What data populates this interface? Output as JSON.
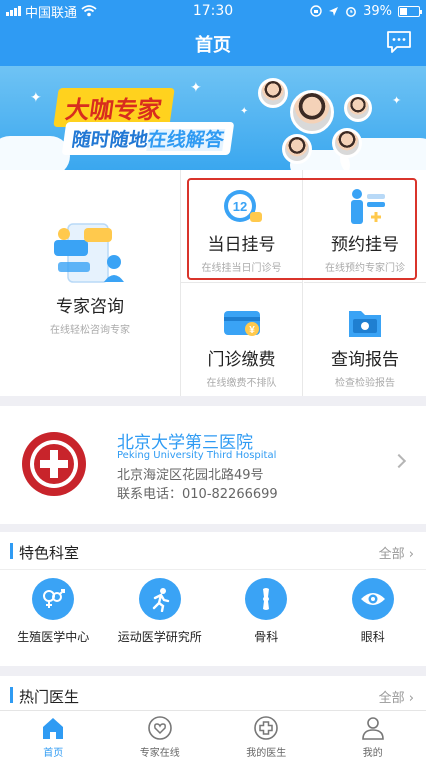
{
  "status_bar": {
    "carrier": "中国联通",
    "time": "17:30",
    "battery": "39%",
    "battery_level": 0.39
  },
  "header": {
    "title": "首页",
    "message_icon": "chat-bubble-icon"
  },
  "banner": {
    "headline": "大咖专家",
    "tagline_part1": "随时随地",
    "tagline_part2": "在线解答"
  },
  "services": {
    "consult": {
      "name": "专家咨询",
      "sub": "在线轻松咨询专家"
    },
    "same_day": {
      "name": "当日挂号",
      "sub": "在线挂当日门诊号",
      "icon_text": "12"
    },
    "appointment": {
      "name": "预约挂号",
      "sub": "在线预约专家门诊"
    },
    "payment": {
      "name": "门诊缴费",
      "sub": "在线缴费不排队",
      "icon_text": "¥"
    },
    "report": {
      "name": "查询报告",
      "sub": "检查检验报告"
    }
  },
  "hospital": {
    "name": "北京大学第三医院",
    "name_en": "Peking University Third Hospital",
    "address": "北京海淀区花园北路49号",
    "phone": "联系电话：010-82266699"
  },
  "departments": {
    "title": "特色科室",
    "more": "全部",
    "items": [
      {
        "label": "生殖医学中心",
        "icon": "gender-symbols-icon"
      },
      {
        "label": "运动医学研究所",
        "icon": "running-person-icon"
      },
      {
        "label": "骨科",
        "icon": "bone-icon"
      },
      {
        "label": "眼科",
        "icon": "eye-icon"
      }
    ]
  },
  "doctors": {
    "title": "热门医生",
    "more": "全部"
  },
  "tabs": [
    {
      "label": "首页",
      "icon": "home-icon",
      "active": true
    },
    {
      "label": "专家在线",
      "icon": "heart-icon",
      "active": false
    },
    {
      "label": "我的医生",
      "icon": "medical-cross-icon",
      "active": false
    },
    {
      "label": "我的",
      "icon": "person-icon",
      "active": false
    }
  ],
  "colors": {
    "primary": "#2f9bf3",
    "highlight": "#d9342b"
  }
}
